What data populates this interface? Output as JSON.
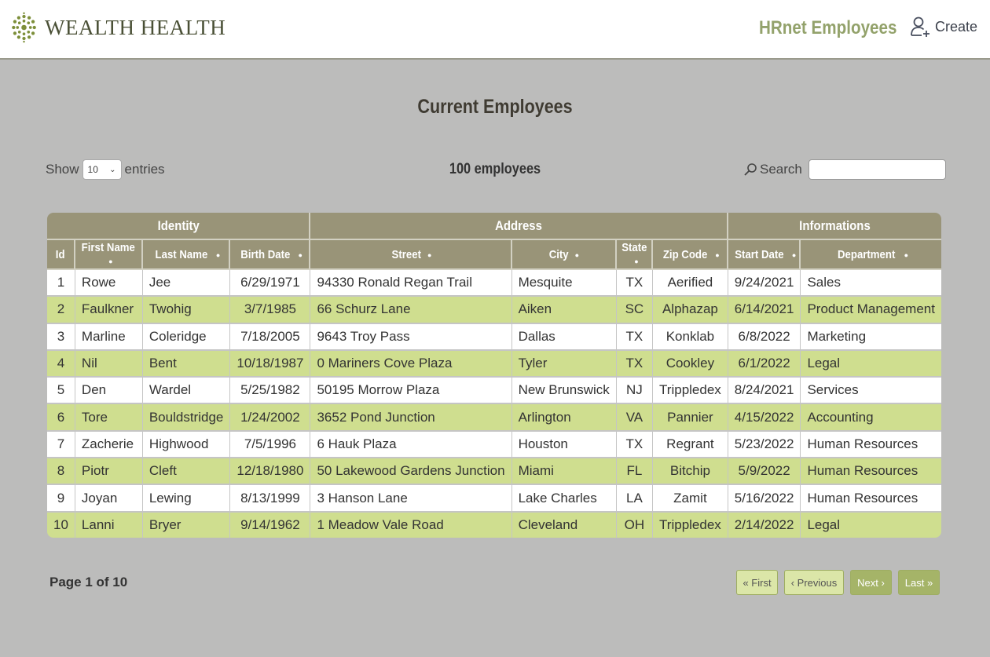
{
  "header": {
    "logo_text": "WEALTH HEALTH",
    "app_title": "HRnet Employees",
    "create_label": "Create"
  },
  "page": {
    "title": "Current Employees",
    "show_label": "Show",
    "entries_value": "10",
    "entries_label": "entries",
    "count_text": "100 employees",
    "search_label": "Search",
    "search_value": ""
  },
  "table": {
    "groups": [
      "Identity",
      "Address",
      "Informations"
    ],
    "columns": [
      "Id",
      "First Name",
      "Last Name",
      "Birth Date",
      "Street",
      "City",
      "State",
      "Zip Code",
      "Start Date",
      "Department"
    ],
    "rows": [
      [
        "1",
        "Rowe",
        "Jee",
        "6/29/1971",
        "94330 Ronald Regan Trail",
        "Mesquite",
        "TX",
        "Aerified",
        "9/24/2021",
        "Sales"
      ],
      [
        "2",
        "Faulkner",
        "Twohig",
        "3/7/1985",
        "66 Schurz Lane",
        "Aiken",
        "SC",
        "Alphazap",
        "6/14/2021",
        "Product Management"
      ],
      [
        "3",
        "Marline",
        "Coleridge",
        "7/18/2005",
        "9643 Troy Pass",
        "Dallas",
        "TX",
        "Konklab",
        "6/8/2022",
        "Marketing"
      ],
      [
        "4",
        "Nil",
        "Bent",
        "10/18/1987",
        "0 Mariners Cove Plaza",
        "Tyler",
        "TX",
        "Cookley",
        "6/1/2022",
        "Legal"
      ],
      [
        "5",
        "Den",
        "Wardel",
        "5/25/1982",
        "50195 Morrow Plaza",
        "New Brunswick",
        "NJ",
        "Trippledex",
        "8/24/2021",
        "Services"
      ],
      [
        "6",
        "Tore",
        "Bouldstridge",
        "1/24/2002",
        "3652 Pond Junction",
        "Arlington",
        "VA",
        "Pannier",
        "4/15/2022",
        "Accounting"
      ],
      [
        "7",
        "Zacherie",
        "Highwood",
        "7/5/1996",
        "6 Hauk Plaza",
        "Houston",
        "TX",
        "Regrant",
        "5/23/2022",
        "Human Resources"
      ],
      [
        "8",
        "Piotr",
        "Cleft",
        "12/18/1980",
        "50 Lakewood Gardens Junction",
        "Miami",
        "FL",
        "Bitchip",
        "5/9/2022",
        "Human Resources"
      ],
      [
        "9",
        "Joyan",
        "Lewing",
        "8/13/1999",
        "3 Hanson Lane",
        "Lake Charles",
        "LA",
        "Zamit",
        "5/16/2022",
        "Human Resources"
      ],
      [
        "10",
        "Lanni",
        "Bryer",
        "9/14/1962",
        "1 Meadow Vale Road",
        "Cleveland",
        "OH",
        "Trippledex",
        "2/14/2022",
        "Legal"
      ]
    ]
  },
  "pagination": {
    "info": "Page 1 of 10",
    "first": "« First",
    "previous": "‹ Previous",
    "next": "Next ›",
    "last": "Last »"
  },
  "colors": {
    "header_green": "#93a26b",
    "table_header": "#999478",
    "row_alt": "#cfde8f",
    "background": "#bcbcbb"
  }
}
